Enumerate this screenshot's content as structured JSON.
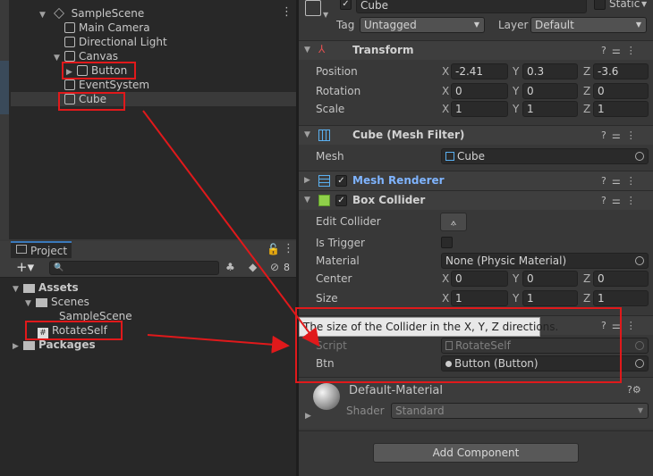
{
  "hierarchy": {
    "scene": "SampleScene",
    "items": [
      {
        "label": "Main Camera"
      },
      {
        "label": "Directional Light"
      },
      {
        "label": "Canvas"
      },
      {
        "label": "Button"
      },
      {
        "label": "EventSystem"
      },
      {
        "label": "Cube"
      }
    ]
  },
  "project": {
    "tab_label": "Project",
    "hidden_count": "8",
    "tree": {
      "assets": "Assets",
      "scenes": "Scenes",
      "sample_scene": "SampleScene",
      "rotate_self": "RotateSelf",
      "packages": "Packages"
    }
  },
  "inspector": {
    "object_name": "Cube",
    "static_label": "Static",
    "tag_label": "Tag",
    "tag_value": "Untagged",
    "layer_label": "Layer",
    "layer_value": "Default",
    "transform": {
      "title": "Transform",
      "position_label": "Position",
      "rotation_label": "Rotation",
      "scale_label": "Scale",
      "position": {
        "x": "-2.41",
        "y": "0.3",
        "z": "-3.6"
      },
      "rotation": {
        "x": "0",
        "y": "0",
        "z": "0"
      },
      "scale": {
        "x": "1",
        "y": "1",
        "z": "1"
      }
    },
    "mesh_filter": {
      "title": "Cube (Mesh Filter)",
      "mesh_label": "Mesh",
      "mesh_value": "Cube"
    },
    "mesh_renderer": {
      "title": "Mesh Renderer"
    },
    "box_collider": {
      "title": "Box Collider",
      "edit_label": "Edit Collider",
      "trigger_label": "Is Trigger",
      "material_label": "Material",
      "material_value": "None (Physic Material)",
      "center_label": "Center",
      "size_label": "Size",
      "center": {
        "x": "0",
        "y": "0",
        "z": "0"
      },
      "size": {
        "x": "1",
        "y": "1",
        "z": "1"
      }
    },
    "tooltip": "The size of the Collider in the X, Y, Z directions.",
    "script_comp": {
      "script_label": "Script",
      "script_value": "RotateSelf",
      "btn_label": "Btn",
      "btn_value": "Button (Button)"
    },
    "material": {
      "name": "Default-Material",
      "shader_label": "Shader",
      "shader_value": "Standard"
    },
    "add_component": "Add Component",
    "axes": {
      "x": "X",
      "y": "Y",
      "z": "Z"
    }
  },
  "colors": {
    "annotation_red": "#e0191b",
    "accent_blue": "#3a79bb",
    "mesh_renderer_title": "#7fb4ff"
  }
}
